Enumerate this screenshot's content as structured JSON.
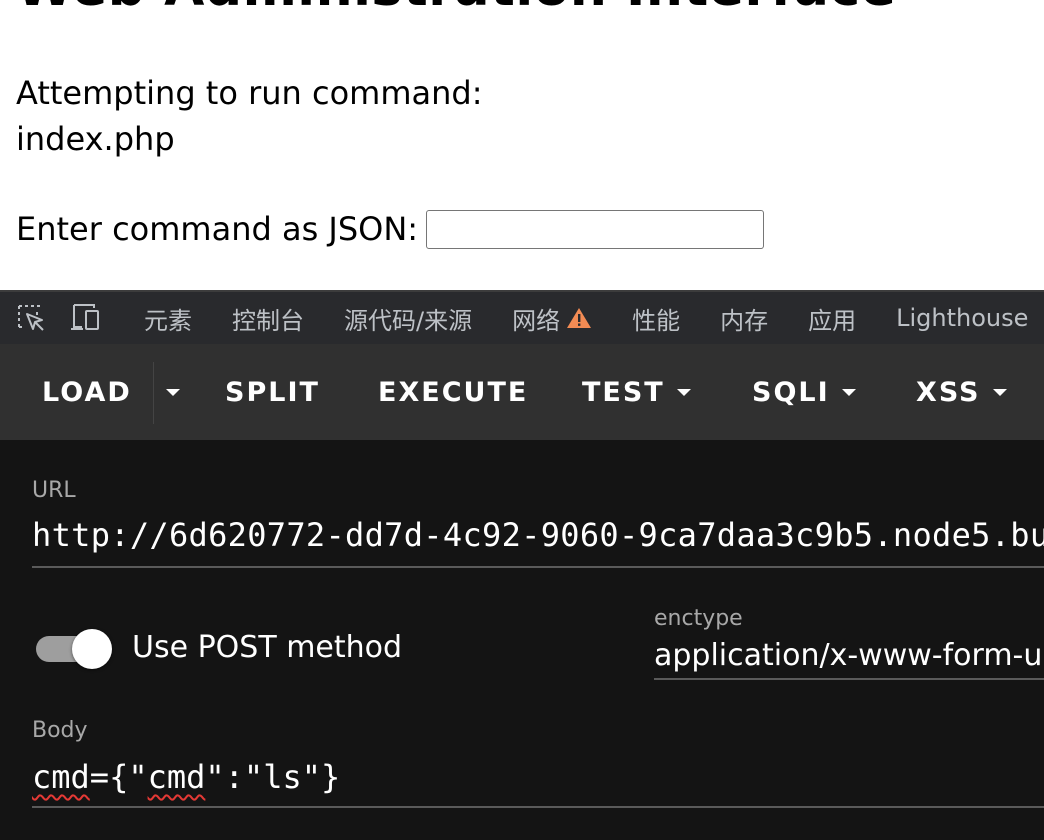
{
  "page": {
    "title": "Web Administration Interface",
    "attempt_label": "Attempting to run command:",
    "attempt_value": "index.php",
    "enter_label": "Enter command as JSON:",
    "json_input_value": ""
  },
  "devtools": {
    "tabs": [
      "元素",
      "控制台",
      "源代码/来源",
      "网络",
      "性能",
      "内存",
      "应用",
      "Lighthouse"
    ],
    "network_warning": true
  },
  "toolbar": {
    "load": "LOAD",
    "split": "SPLIT",
    "execute": "EXECUTE",
    "test": "TEST",
    "sqli": "SQLI",
    "xss": "XSS"
  },
  "form": {
    "url_label": "URL",
    "url_value": "http://6d620772-dd7d-4c92-9060-9ca7daa3c9b5.node5.bu",
    "post_label": "Use POST method",
    "post_enabled": true,
    "enctype_label": "enctype",
    "enctype_value": "application/x-www-form-ur",
    "body_label": "Body",
    "body_parts": [
      "cmd",
      "={\"",
      "cmd",
      "\":\"ls\"}"
    ]
  },
  "colors": {
    "devtools_bg": "#292a2d",
    "toolbar_bg": "#303030",
    "form_bg": "#141414",
    "warning": "#f28b54"
  }
}
